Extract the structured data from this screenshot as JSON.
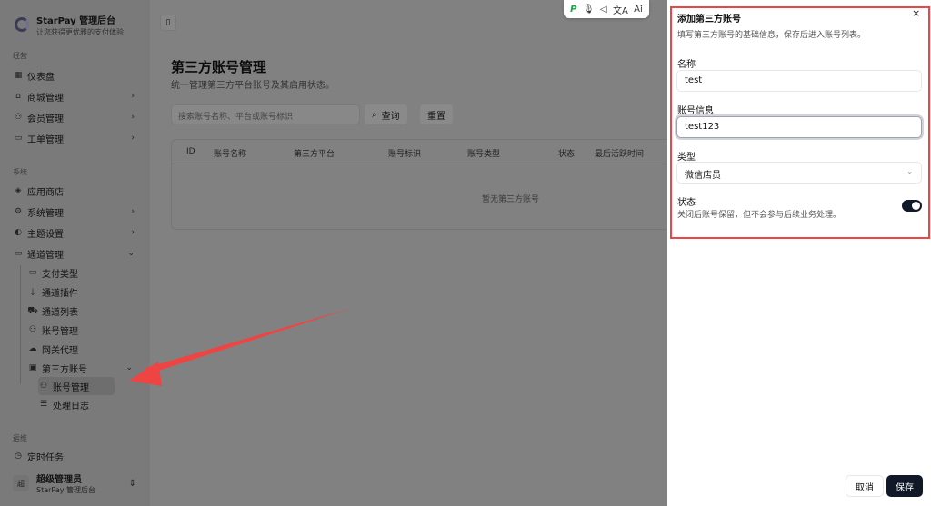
{
  "app": {
    "title": "StarPay 管理后台",
    "subtitle": "让您获得更优雅的支付体验"
  },
  "sidebar": {
    "groups": {
      "ops": "经营",
      "system": "系统",
      "maint": "运维"
    },
    "items": {
      "dashboard": "仪表盘",
      "mall": "商城管理",
      "member": "会员管理",
      "ticket": "工单管理",
      "appstore": "应用商店",
      "syssettings": "系统管理",
      "theme": "主题设置",
      "channel": "通道管理",
      "paytype": "支付类型",
      "plugins": "通道插件",
      "channel_list": "通道列表",
      "accounts": "账号管理",
      "gateway": "网关代理",
      "third_party": "第三方账号",
      "tp_accounts": "账号管理",
      "logs": "处理日志",
      "cron": "定时任务"
    },
    "user": {
      "avatar": "超",
      "name": "超级管理员",
      "sub": "StarPay 管理后台"
    }
  },
  "main": {
    "title": "第三方账号管理",
    "subtitle": "统一管理第三方平台账号及其启用状态。",
    "search_placeholder": "搜索账号名称、平台或账号标识",
    "query": "查询",
    "reset": "重置",
    "columns": [
      "ID",
      "账号名称",
      "第三方平台",
      "账号标识",
      "账号类型",
      "状态",
      "最后活跃时间"
    ],
    "empty": "暂无第三方账号"
  },
  "toolbar": [
    "P",
    "🎙",
    "◁",
    "文A",
    "Aǐ"
  ],
  "drawer": {
    "title": "添加第三方账号",
    "desc": "填写第三方账号的基础信息，保存后进入账号列表。",
    "name_label": "名称",
    "name_value": "test",
    "info_label": "账号信息",
    "info_value": "test123",
    "type_label": "类型",
    "type_value": "微信店员",
    "status_label": "状态",
    "status_desc": "关闭后账号保留，但不会参与后续业务处理。",
    "status_on": true,
    "cancel": "取消",
    "save": "保存",
    "close": "×"
  }
}
